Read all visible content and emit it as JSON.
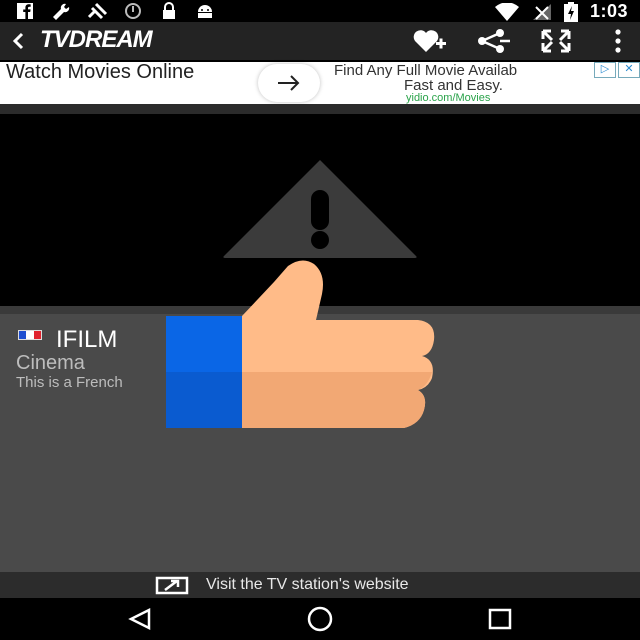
{
  "status_bar": {
    "time": "1:03",
    "icons_left": [
      "facebook-icon",
      "wrench-icon",
      "satellite-icon",
      "block-icon",
      "lock-icon",
      "android-icon"
    ],
    "icons_right": [
      "wifi-icon",
      "signal-icon",
      "battery-icon"
    ]
  },
  "toolbar": {
    "title": "TVDREAM",
    "actions": [
      "favorite-add-icon",
      "share-icon",
      "fullscreen-icon",
      "overflow-menu-icon"
    ]
  },
  "ad": {
    "title": "Watch Movies Online",
    "headline": "Find Any Full Movie Availab",
    "subline": "Fast and Easy.",
    "url": "yidio.com/Movies",
    "badge_info": "▷",
    "badge_close": "✕"
  },
  "channel": {
    "name": "IFILM",
    "genre": "Cinema",
    "description": "This is a French",
    "flag_colors": [
      "#1f4fd1",
      "#ffffff",
      "#e0232e"
    ]
  },
  "footer": {
    "visit_label": "Visit the TV station's website"
  },
  "colors": {
    "toolbar_bg": "#232323",
    "panel_bg": "#4a4a4a",
    "ad_url": "#2aa34a",
    "cuff_blue": "#0a66e6",
    "thumb_skin": "#ffbb88"
  }
}
